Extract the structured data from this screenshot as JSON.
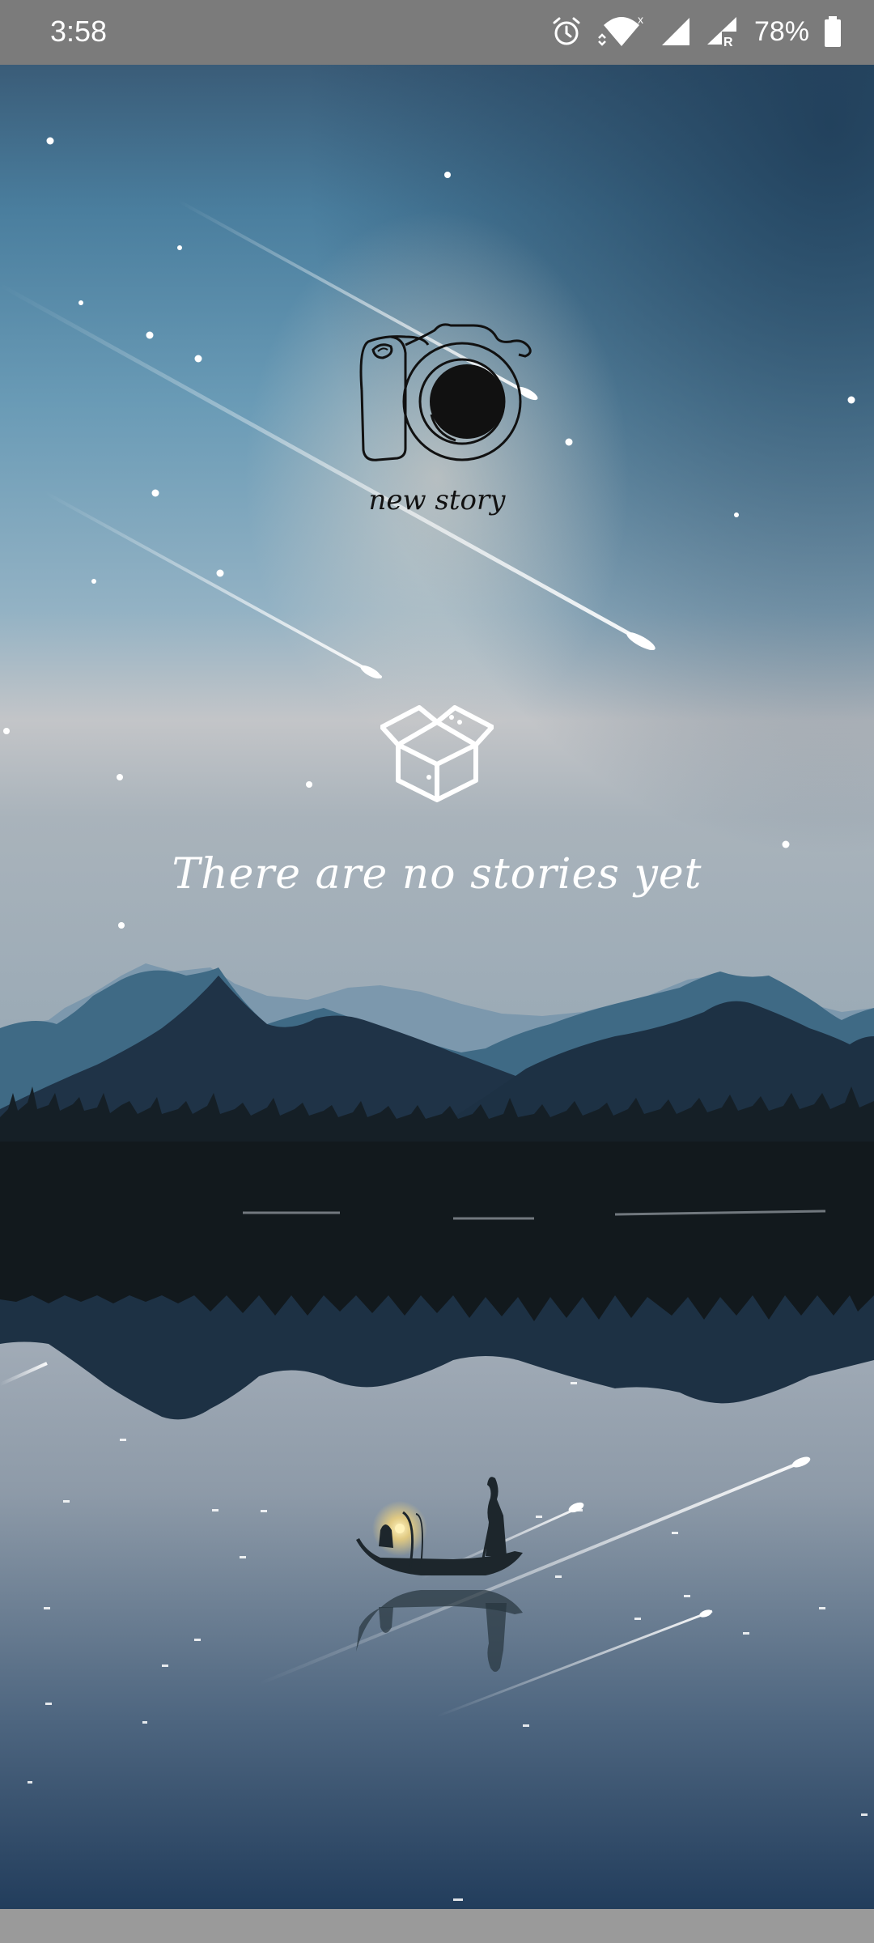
{
  "status_bar": {
    "time": "3:58",
    "battery_percent": "78%",
    "icons": [
      "alarm-icon",
      "wifi-icon",
      "cell-signal-icon",
      "cell-signal-roaming-icon",
      "battery-icon"
    ]
  },
  "new_story": {
    "label": "new story",
    "icon": "camera-icon"
  },
  "empty_state": {
    "icon": "open-box-icon",
    "message": "There are no stories yet"
  },
  "colors": {
    "sky_top": "#31526e",
    "sky_mid": "#6a9bb6",
    "horizon": "#b9c4cc",
    "mountain_dark": "#1f3347",
    "forest": "#12191d",
    "water": "#8f9eac",
    "status_bar": "#7b7b7b"
  }
}
